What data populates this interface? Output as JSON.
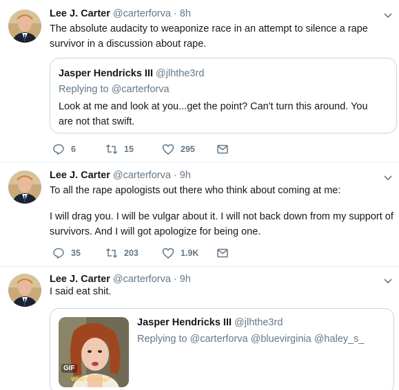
{
  "colors": {
    "text": "#14171a",
    "secondary": "#657786",
    "border": "#e6ecf0"
  },
  "tweets": [
    {
      "author": "Lee J. Carter",
      "handle": "@carterforva",
      "time": "· 8h",
      "text": "The absolute audacity to weaponize race in an attempt to silence a rape survivor in a discussion about rape.",
      "quote": {
        "author": "Jasper Hendricks III",
        "handle": "@jlhthe3rd",
        "reply": "Replying to @carterforva",
        "text": "Look at me and look at you...get the point?  Can't turn this around.  You are not that swift."
      },
      "replies": "6",
      "retweets": "15",
      "likes": "295"
    },
    {
      "author": "Lee J. Carter",
      "handle": "@carterforva",
      "time": "· 9h",
      "text1": "To all the rape apologists out there who think about coming at me:",
      "text2": "I will drag you.  I will be vulgar about it.  I will not back down from my support of survivors.  And I will got apologize for being one.",
      "replies": "35",
      "retweets": "203",
      "likes": "1.9K"
    },
    {
      "author": "Lee J. Carter",
      "handle": "@carterforva",
      "time": "· 9h",
      "text": "I said eat shit.",
      "quote": {
        "author": "Jasper Hendricks III",
        "handle": "@jlhthe3rd",
        "reply": "Replying to @carterforva @bluevirginia @haley_s_",
        "gif_badge": "GIF",
        "gif_caption": "What's wrong?"
      }
    }
  ],
  "icons": {
    "reply": "reply-icon",
    "retweet": "retweet-icon",
    "like": "heart-icon",
    "dm": "envelope-icon",
    "more": "chevron-down-icon"
  }
}
